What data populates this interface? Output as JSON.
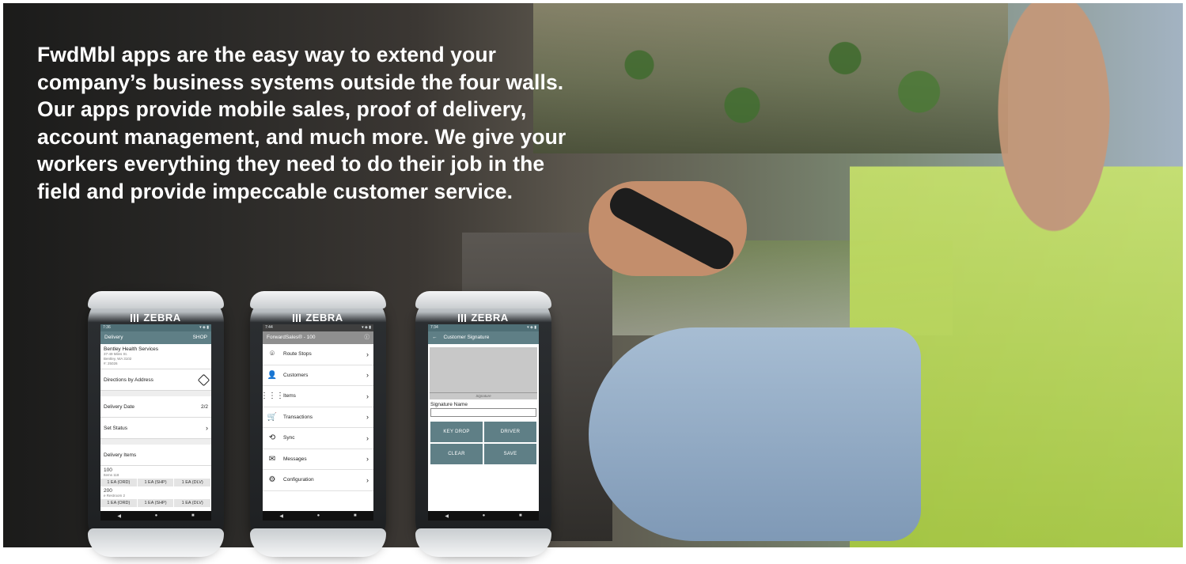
{
  "headline": "FwdMbl apps are the easy way to extend your company’s business systems outside the four walls. Our apps provide mobile sales, proof of delivery, account management, and much more. We give your workers everything they need to do their job in the field and provide impeccable customer service.",
  "device_brand": "ZEBRA",
  "colors": {
    "app_teal": "#5f7f86",
    "vest_green": "#c8e36b",
    "headline_text": "#ffffff"
  },
  "phone1": {
    "status_left": "7:36",
    "appbar_title": "Delivery",
    "appbar_action": "SHOP",
    "customer_name": "Bentley Health Services",
    "customer_address": "37-49 Miles St.",
    "customer_city": "Bentley, WA 3102",
    "customer_id": "#: 25026",
    "directions": "Directions by Address",
    "delivery_date_label": "Delivery Date",
    "delivery_date_value": "2/2",
    "set_status": "Set Status",
    "items_header": "Delivery Items",
    "items": [
      {
        "qty": "100",
        "desc": "Items 118",
        "chips": [
          "1 EA (ORD)",
          "1 EA (SHP)",
          "1 EA (DLV)"
        ]
      },
      {
        "qty": "200",
        "desc": "e Restroom 2",
        "chips": [
          "1 EA (ORD)",
          "1 EA (SHP)",
          "1 EA (DLV)"
        ]
      }
    ]
  },
  "phone2": {
    "status_left": "7:44",
    "appbar_title": "ForwardSales® - 100",
    "menu": [
      {
        "label": "Route Stops",
        "icon": "location-pin-icon",
        "glyph": "⌾"
      },
      {
        "label": "Customers",
        "icon": "person-icon",
        "glyph": "👤"
      },
      {
        "label": "Items",
        "icon": "grid-icon",
        "glyph": "⋮⋮⋮"
      },
      {
        "label": "Transactions",
        "icon": "cart-icon",
        "glyph": "🛒"
      },
      {
        "label": "Sync",
        "icon": "sync-icon",
        "glyph": "⟲"
      },
      {
        "label": "Messages",
        "icon": "mail-icon",
        "glyph": "✉"
      },
      {
        "label": "Configuration",
        "icon": "gear-icon",
        "glyph": "⚙"
      }
    ]
  },
  "phone3": {
    "status_left": "7:34",
    "appbar_back": "←",
    "appbar_title": "Customer Signature",
    "sig_caption": "Signature",
    "sig_name_label": "Signature Name",
    "buttons": [
      "KEY DROP",
      "DRIVER",
      "CLEAR",
      "SAVE"
    ]
  },
  "nav": {
    "back": "◀",
    "home": "●",
    "recents": "■"
  }
}
